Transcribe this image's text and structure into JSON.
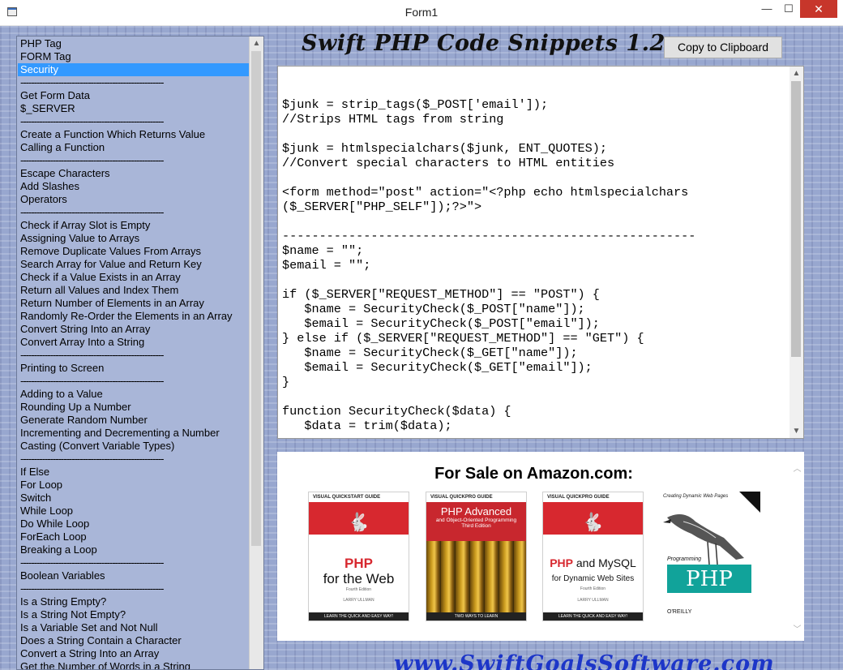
{
  "window": {
    "title": "Form1",
    "minimize_glyph": "—",
    "maximize_glyph": "☐",
    "close_glyph": "✕"
  },
  "list": {
    "items": [
      "PHP Tag",
      "FORM Tag",
      "Security",
      "-----------------------------------------------------",
      "Get Form Data",
      "$_SERVER",
      "-----------------------------------------------------",
      "Create a Function Which Returns Value",
      "Calling a Function",
      "-----------------------------------------------------",
      "Escape Characters",
      "Add Slashes",
      "Operators",
      "-----------------------------------------------------",
      "Check if Array Slot is Empty",
      "Assigning Value to Arrays",
      "Remove Duplicate Values From Arrays",
      "Search Array for Value and Return Key",
      "Check if a Value Exists in an Array",
      "Return all Values and Index Them",
      "Return Number of Elements in an Array",
      "Randomly Re-Order the Elements in an Array",
      "Convert String Into an Array",
      "Convert Array Into a String",
      "-----------------------------------------------------",
      "Printing to Screen",
      "-----------------------------------------------------",
      "Adding to a Value",
      "Rounding Up a Number",
      "Generate Random Number",
      "Incrementing and Decrementing a Number",
      "Casting (Convert Variable Types)",
      "-----------------------------------------------------",
      "If Else",
      "For Loop",
      "Switch",
      "While Loop",
      "Do While Loop",
      "ForEach Loop",
      "Breaking a Loop",
      "-----------------------------------------------------",
      "Boolean Variables",
      "-----------------------------------------------------",
      "Is a String Empty?",
      "Is a String Not Empty?",
      "Is a Variable Set and Not Null",
      "Does a String Contain a Character",
      "Convert a String Into an Array",
      "Get the Number of Words in a String"
    ],
    "selected_index": 2
  },
  "header": {
    "title": "Swift PHP Code Snippets 1.2",
    "copy_button": "Copy to Clipboard"
  },
  "code": {
    "text": "$junk = strip_tags($_POST['email']);\n//Strips HTML tags from string\n\n$junk = htmlspecialchars($junk, ENT_QUOTES);\n//Convert special characters to HTML entities\n\n<form method=\"post\" action=\"<?php echo htmlspecialchars\n($_SERVER[\"PHP_SELF\"]);?>\">\n\n--------------------------------------------------------\n$name = \"\";\n$email = \"\";\n\nif ($_SERVER[\"REQUEST_METHOD\"] == \"POST\") {\n   $name = SecurityCheck($_POST[\"name\"]);\n   $email = SecurityCheck($_POST[\"email\"]);\n} else if ($_SERVER[\"REQUEST_METHOD\"] == \"GET\") {\n   $name = SecurityCheck($_GET[\"name\"]);\n   $email = SecurityCheck($_GET[\"email\"]);\n}\n\nfunction SecurityCheck($data) {\n   $data = trim($data);"
  },
  "ad": {
    "heading": "For Sale on Amazon.com:",
    "books": [
      {
        "series": "VISUAL QUICKSTART GUIDE",
        "title_main": "PHP",
        "title_rest": "for the Web",
        "edition": "Fourth Edition",
        "author": "LARRY ULLMAN",
        "footer": "LEARN THE QUICK AND EASY WAY!"
      },
      {
        "series": "VISUAL QUICKPRO GUIDE",
        "title_main": "PHP Advanced",
        "subtitle": "and Object-Oriented Programming",
        "edition": "Third Edition",
        "footer": "TWO WAYS TO LEARN"
      },
      {
        "series": "VISUAL QUICKPRO GUIDE",
        "title_main": "PHP",
        "title_rest": "and MySQL",
        "subtitle": "for Dynamic Web Sites",
        "edition": "Fourth Edition",
        "author": "LARRY ULLMAN",
        "footer": "LEARN THE QUICK AND EASY WAY!"
      },
      {
        "series": "Creating Dynamic Web Pages",
        "title_main": "PHP",
        "prefix": "Programming",
        "publisher": "O'REILLY"
      }
    ]
  },
  "footer": {
    "url": "www.SwiftGoalsSoftware.com"
  },
  "icons": {
    "scroll_up": "▲",
    "scroll_down": "▼",
    "chevron_up": "︿",
    "chevron_down": "﹀",
    "rabbit": "🐇"
  }
}
